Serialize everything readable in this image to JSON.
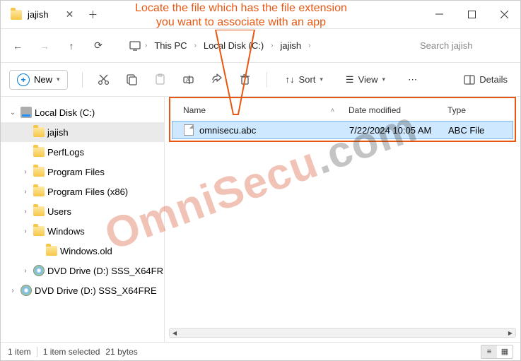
{
  "annotation": {
    "line1": "Locate the file which has the file extension",
    "line2": "you want to associate with an app"
  },
  "watermark": {
    "part1": "OmniSecu",
    "part2": ".com"
  },
  "title": {
    "tab": "jajish"
  },
  "breadcrumb": {
    "pc": "This PC",
    "drive": "Local Disk (C:)",
    "folder": "jajish"
  },
  "search": {
    "placeholder": "Search jajish"
  },
  "toolbar": {
    "new": "New",
    "sort": "Sort",
    "view": "View",
    "details": "Details"
  },
  "tree": {
    "local_disk": "Local Disk (C:)",
    "jajish": "jajish",
    "perflogs": "PerfLogs",
    "program_files": "Program Files",
    "program_files_x86": "Program Files (x86)",
    "users": "Users",
    "windows": "Windows",
    "windows_old": "Windows.old",
    "dvd1": "DVD Drive (D:) SSS_X64FR",
    "dvd2": "DVD Drive (D:) SSS_X64FRE"
  },
  "columns": {
    "name": "Name",
    "date": "Date modified",
    "type": "Type"
  },
  "files": [
    {
      "name": "omnisecu.abc",
      "date": "7/22/2024 10:05 AM",
      "type": "ABC File"
    }
  ],
  "status": {
    "count": "1 item",
    "selected": "1 item selected",
    "size": "21 bytes"
  }
}
